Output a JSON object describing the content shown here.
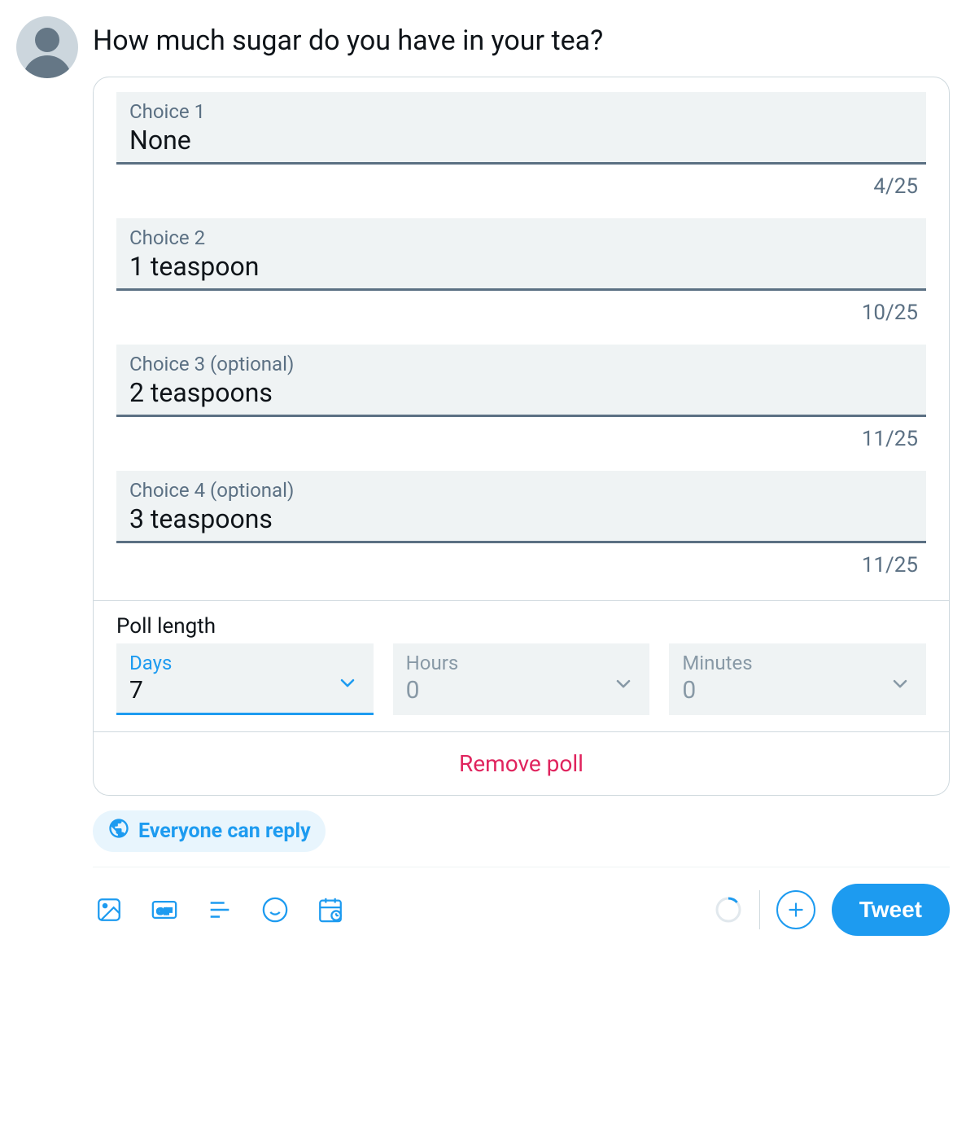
{
  "tweet_text": "How much sugar do you have in your tea?",
  "poll": {
    "max_choice_length": 25,
    "choices": [
      {
        "label": "Choice 1",
        "value": "None",
        "count": 4
      },
      {
        "label": "Choice 2",
        "value": "1 teaspoon",
        "count": 10
      },
      {
        "label": "Choice 3 (optional)",
        "value": "2 teaspoons",
        "count": 11
      },
      {
        "label": "Choice 4 (optional)",
        "value": "3 teaspoons",
        "count": 11
      }
    ],
    "length": {
      "title": "Poll length",
      "days": {
        "label": "Days",
        "value": "7",
        "active": true
      },
      "hours": {
        "label": "Hours",
        "value": "0",
        "active": false
      },
      "minutes": {
        "label": "Minutes",
        "value": "0",
        "active": false
      }
    },
    "remove_label": "Remove poll"
  },
  "reply_setting": "Everyone can reply",
  "tweet_button_label": "Tweet",
  "counters": {
    "choice1": "4/25",
    "choice2": "10/25",
    "choice3": "11/25",
    "choice4": "11/25"
  },
  "colors": {
    "accent": "#1d9bf0",
    "danger": "#e0245e",
    "muted": "#5b7083",
    "field_bg": "#eff3f4"
  }
}
